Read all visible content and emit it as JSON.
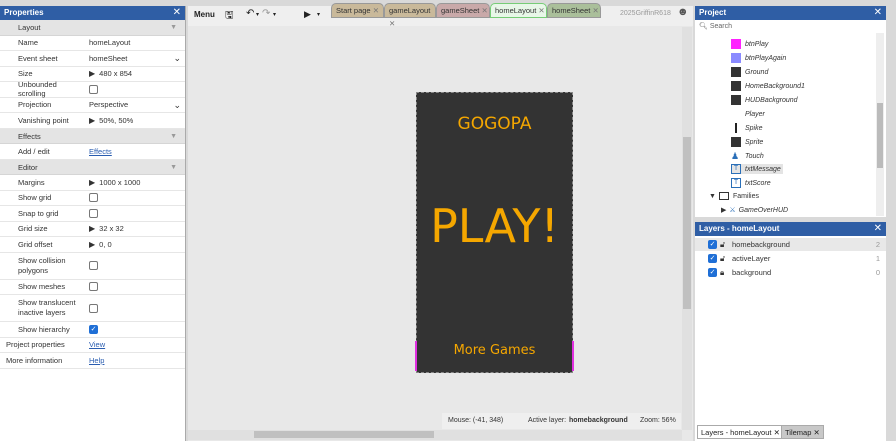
{
  "properties": {
    "title": "Properties",
    "close": "✕",
    "sections": {
      "layout": "Layout",
      "effects": "Effects",
      "editor": "Editor"
    },
    "rows": {
      "name_label": "Name",
      "name_value": "homeLayout",
      "eventsheet_label": "Event sheet",
      "eventsheet_value": "homeSheet",
      "size_label": "Size",
      "size_value": "480 x 854",
      "unbounded_label": "Unbounded scrolling",
      "projection_label": "Projection",
      "projection_value": "Perspective",
      "vanishing_label": "Vanishing point",
      "vanishing_value": "50%, 50%",
      "addedit_label": "Add / edit",
      "addedit_value": "Effects",
      "margins_label": "Margins",
      "margins_value": "1000 x 1000",
      "showgrid_label": "Show grid",
      "snap_label": "Snap to grid",
      "gridsize_label": "Grid size",
      "gridsize_value": "32 x 32",
      "gridoffset_label": "Grid offset",
      "gridoffset_value": "0, 0",
      "collision_label1": "Show collision",
      "collision_label2": "polygons",
      "meshes_label": "Show meshes",
      "translucent_label1": "Show translucent",
      "translucent_label2": "inactive layers",
      "hierarchy_label": "Show hierarchy",
      "projprops_label": "Project properties",
      "projprops_value": "View",
      "moreinfo_label": "More information",
      "moreinfo_value": "Help"
    }
  },
  "toolbar": {
    "menu": "Menu",
    "tabs": [
      "Start page",
      "gameLayout",
      "gameSheet",
      "homeLayout",
      "homeSheet"
    ],
    "user": "2025GriffinR618"
  },
  "canvas": {
    "title_text": "GOGOPA",
    "play_text": "PLAY!",
    "more_text": "More Games"
  },
  "status": {
    "mouse": "Mouse: (-41, 348)",
    "active_layer_label": "Active layer:",
    "active_layer_value": "homebackground",
    "zoom": "Zoom: 56%"
  },
  "project": {
    "title": "Project",
    "search_placeholder": "Search",
    "items": [
      "btnPlay",
      "btnPlayAgain",
      "Ground",
      "HomeBackground1",
      "HUDBackground",
      "Player",
      "Spike",
      "Sprite",
      "Touch",
      "txtMessage",
      "txtScore"
    ],
    "families_label": "Families",
    "family_item": "GameOverHUD"
  },
  "layers": {
    "title": "Layers - homeLayout",
    "rows": [
      {
        "name": "homebackground",
        "index": "2"
      },
      {
        "name": "activeLayer",
        "index": "1"
      },
      {
        "name": "background",
        "index": "0"
      }
    ]
  },
  "bottom_tabs": [
    "Layers - homeLayout",
    "Tilemap"
  ],
  "colors": {
    "accent": "#2f5ea5",
    "canvas_text": "#f5a700",
    "canvas_bg": "#333333"
  }
}
